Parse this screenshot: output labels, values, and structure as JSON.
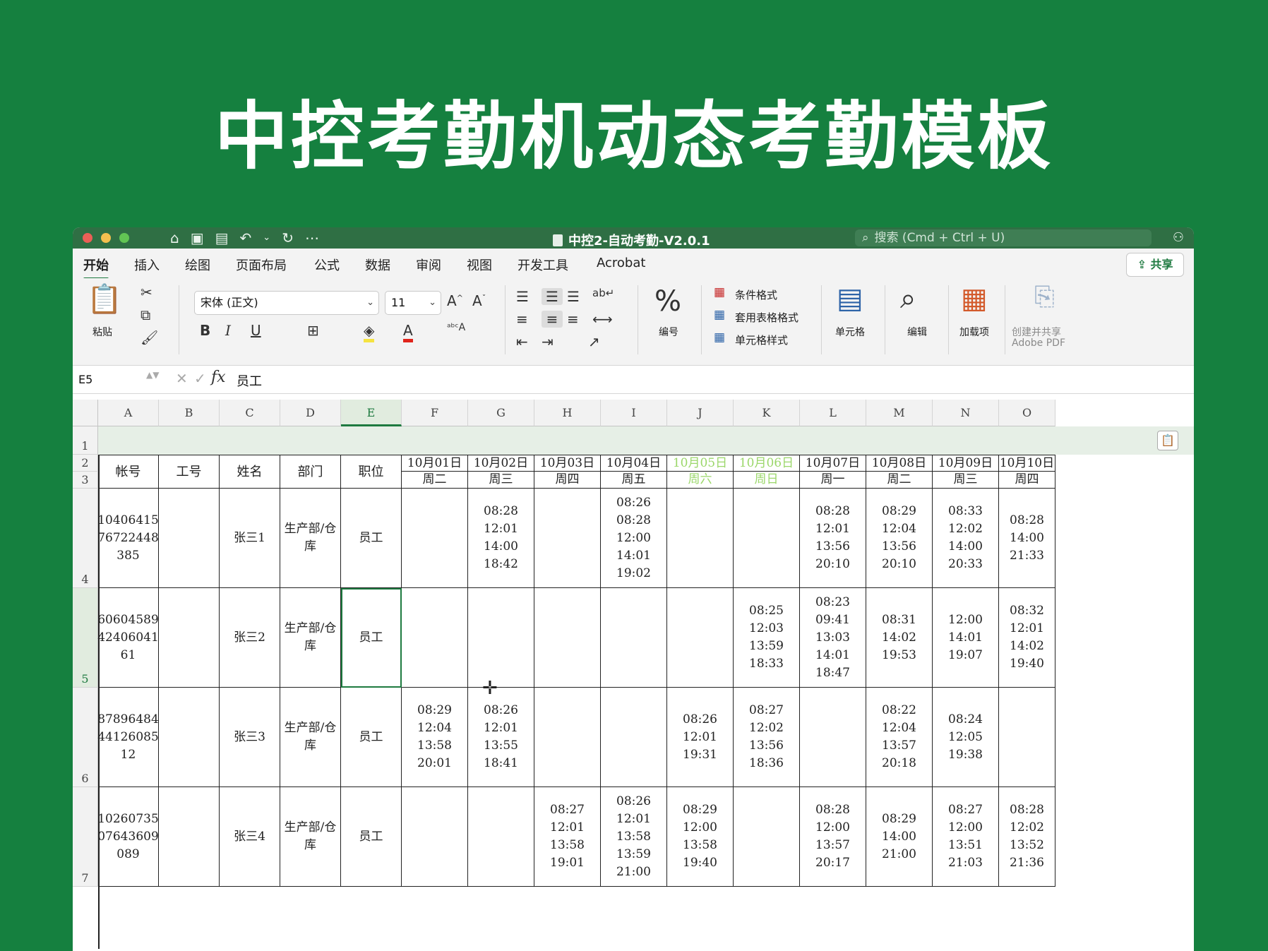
{
  "banner": {
    "title": "中控考勤机动态考勤模板"
  },
  "window": {
    "title": "中控2-自动考勤-V2.0.1",
    "search_placeholder": "搜索 (Cmd + Ctrl + U)"
  },
  "ribbon_tabs": [
    "开始",
    "插入",
    "绘图",
    "页面布局",
    "公式",
    "数据",
    "审阅",
    "视图",
    "开发工具",
    "Acrobat"
  ],
  "share_label": "共享",
  "ribbon": {
    "paste_label": "粘贴",
    "font_name": "宋体 (正文)",
    "font_size": "11",
    "number_label": "编号",
    "cond_format": "条件格式",
    "table_format": "套用表格格式",
    "cell_style": "单元格样式",
    "cells_label": "单元格",
    "edit_label": "编辑",
    "addins_label": "加载项",
    "pdf_label_1": "创建并共享",
    "pdf_label_2": "Adobe PDF"
  },
  "formula_bar": {
    "name_box": "E5",
    "value": "员工"
  },
  "columns": [
    "A",
    "B",
    "C",
    "D",
    "E",
    "F",
    "G",
    "H",
    "I",
    "J",
    "K",
    "L",
    "M",
    "N",
    "O"
  ],
  "rows": [
    "1",
    "2",
    "3",
    "4",
    "5",
    "6",
    "7"
  ],
  "headers": {
    "account": "帐号",
    "job_no": "工号",
    "name": "姓名",
    "dept": "部门",
    "position": "职位"
  },
  "dates": [
    {
      "date": "10月01日",
      "weekday": "周二"
    },
    {
      "date": "10月02日",
      "weekday": "周三"
    },
    {
      "date": "10月03日",
      "weekday": "周四"
    },
    {
      "date": "10月04日",
      "weekday": "周五"
    },
    {
      "date": "10月05日",
      "weekday": "周六"
    },
    {
      "date": "10月06日",
      "weekday": "周日"
    },
    {
      "date": "10月07日",
      "weekday": "周一"
    },
    {
      "date": "10月08日",
      "weekday": "周二"
    },
    {
      "date": "10月09日",
      "weekday": "周三"
    },
    {
      "date": "10月10日",
      "weekday": "周四"
    }
  ],
  "employees": [
    {
      "account": "10406415\n76722448\n385",
      "job_no": "",
      "name": "张三1",
      "dept": "生产部/仓\n库",
      "position": "员工",
      "times": [
        "",
        "08:28\n12:01\n14:00\n18:42",
        "",
        "08:26\n08:28\n12:00\n14:01\n19:02",
        "",
        "",
        "08:28\n12:01\n13:56\n20:10",
        "08:29\n12:04\n13:56\n20:10",
        "08:33\n12:02\n14:00\n20:33",
        "08:28\n14:00\n21:33"
      ]
    },
    {
      "account": "60604589\n42406041\n61",
      "job_no": "",
      "name": "张三2",
      "dept": "生产部/仓\n库",
      "position": "员工",
      "times": [
        "",
        "",
        "",
        "",
        "",
        "08:25\n12:03\n13:59\n18:33",
        "08:23\n09:41\n13:03\n14:01\n18:47",
        "08:31\n14:02\n19:53",
        "12:00\n14:01\n19:07",
        "08:32\n12:01\n14:02\n19:40"
      ]
    },
    {
      "account": "87896484\n44126085\n12",
      "job_no": "",
      "name": "张三3",
      "dept": "生产部/仓\n库",
      "position": "员工",
      "times": [
        "08:29\n12:04\n13:58\n20:01",
        "08:26\n12:01\n13:55\n18:41",
        "",
        "",
        "08:26\n12:01\n19:31",
        "08:27\n12:02\n13:56\n18:36",
        "",
        "08:22\n12:04\n13:57\n20:18",
        "08:24\n12:05\n19:38",
        ""
      ]
    },
    {
      "account": "10260735\n07643609\n089",
      "job_no": "",
      "name": "张三4",
      "dept": "生产部/仓\n库",
      "position": "员工",
      "times": [
        "",
        "",
        "08:27\n12:01\n13:58\n19:01",
        "08:26\n12:01\n13:58\n13:59\n21:00",
        "08:29\n12:00\n13:58\n19:40",
        "",
        "08:28\n12:00\n13:57\n20:17",
        "08:29\n14:00\n21:00",
        "08:27\n12:00\n13:51\n21:03",
        "08:28\n12:02\n13:52\n21:36"
      ]
    }
  ],
  "colors": {
    "banner_bg": "#15803f",
    "accent": "#1e7a40",
    "weekend_text": "#9bd76a"
  }
}
